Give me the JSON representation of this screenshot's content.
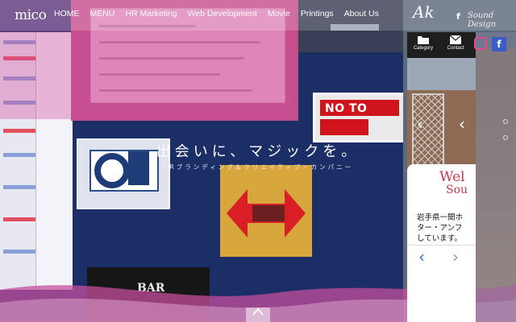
{
  "header": {
    "logo": "mico",
    "nav": [
      "HOME",
      "MENU",
      "HR Marketing",
      "Web Development",
      "Movie",
      "Printings",
      "About Us"
    ],
    "brand": "Ak",
    "brand_sub": "Sound Design"
  },
  "hero": {
    "tagline": "出会いに、マジックを。",
    "subline": "HRブランディング＆クリエイティブ・カンパニー"
  },
  "collage": {
    "sign_text": "NO TO WAR",
    "bar_text": "BAR"
  },
  "phone": {
    "nav": [
      {
        "label": "Category",
        "icon": "folder-icon"
      },
      {
        "label": "Contact",
        "icon": "mail-icon"
      }
    ],
    "welcome": "Wel",
    "sound": "Sou",
    "jp_text": "岩手県一関ホ\nター・アンフ\nしています。"
  },
  "colors": {
    "accent_pink": "#c23b52",
    "facebook": "#3b5bc9",
    "instagram": "#e24a8a",
    "navy": "#1b2e66"
  }
}
